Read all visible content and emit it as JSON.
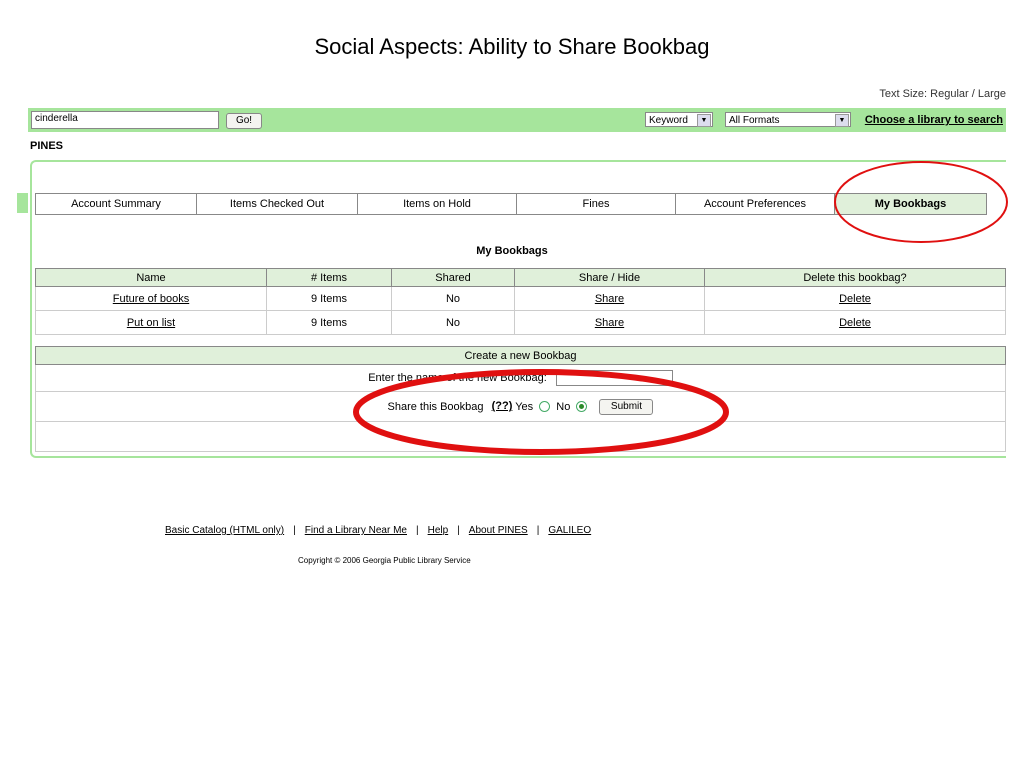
{
  "slide": {
    "title": "Social Aspects: Ability to Share Bookbag"
  },
  "header": {
    "text_size": "Text Size: Regular / Large",
    "search_value": "cinderella",
    "go_label": "Go!",
    "search_type": "Keyword",
    "format": "All Formats",
    "choose_library": "Choose a library to search"
  },
  "org": "PINES",
  "tabs": [
    "Account Summary",
    "Items Checked Out",
    "Items on Hold",
    "Fines",
    "Account Preferences",
    "My Bookbags"
  ],
  "bookbags": {
    "title": "My Bookbags",
    "columns": [
      "Name",
      "# Items",
      "Shared",
      "Share / Hide",
      "Delete this bookbag?"
    ],
    "rows": [
      {
        "name": "Future of books",
        "items": "9 Items",
        "shared": "No",
        "share": "Share",
        "delete": "Delete"
      },
      {
        "name": "Put on list",
        "items": "9 Items",
        "shared": "No",
        "share": "Share",
        "delete": "Delete"
      }
    ]
  },
  "create": {
    "header": "Create a new Bookbag",
    "name_label": "Enter the name of the new Bookbag:",
    "share_label": "Share this Bookbag",
    "help_link": "(??)",
    "yes": "Yes",
    "no": "No",
    "submit": "Submit"
  },
  "footer": {
    "links": [
      "Basic Catalog (HTML only)",
      "Find a Library Near Me",
      "Help",
      "About PINES",
      "GALILEO"
    ],
    "separator": "|",
    "copyright": "Copyright © 2006 Georgia Public Library Service"
  },
  "annotations": {
    "color": "#e01010"
  }
}
